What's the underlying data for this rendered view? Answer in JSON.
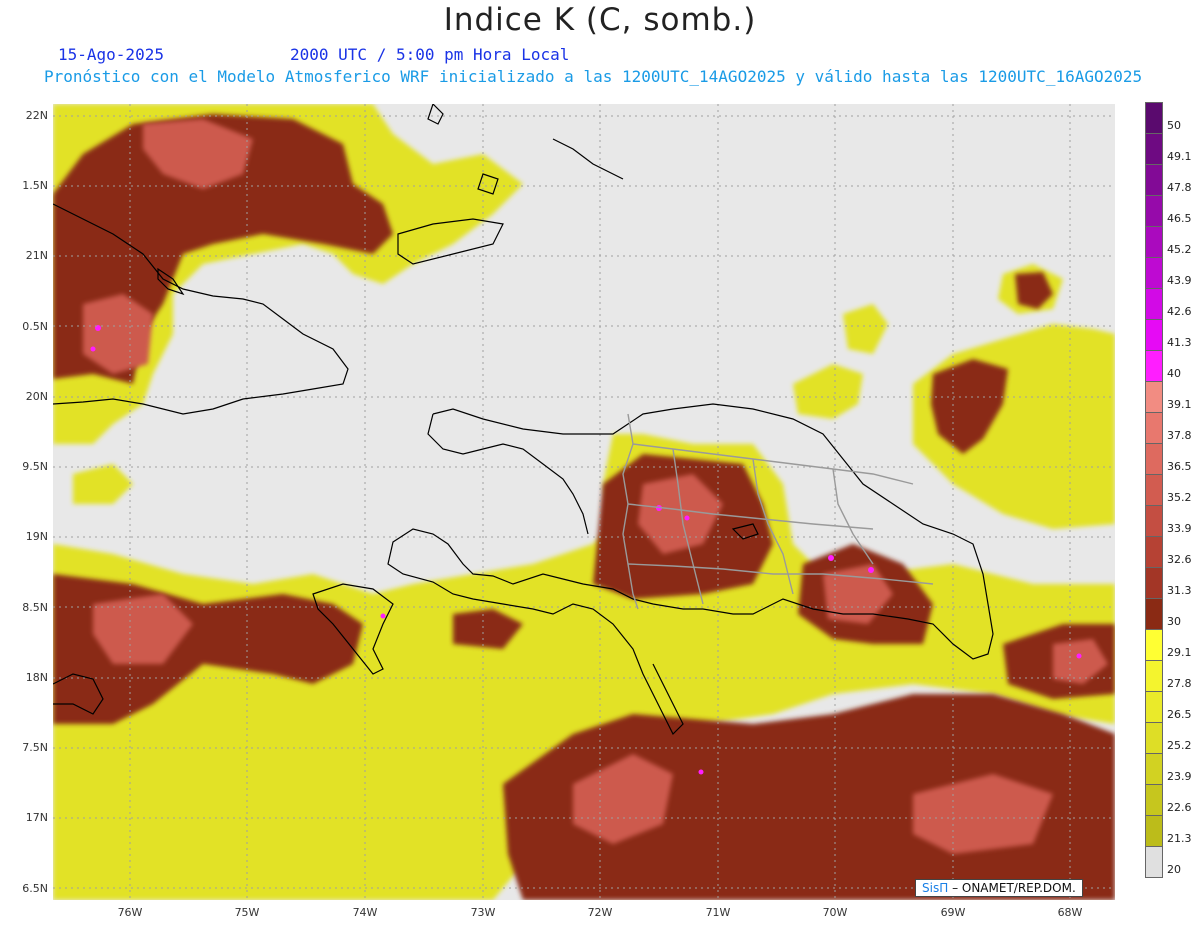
{
  "header": {
    "title": "Indice K (C, somb.)",
    "date": "15-Ago-2025",
    "time": "2000 UTC / 5:00 pm Hora Local",
    "subtitle": "Pronóstico con el Modelo Atmosferico WRF inicializado a las 1200UTC_14AGO2025 y válido hasta las  1200UTC_16AGO2025"
  },
  "axes": {
    "lat_labels": [
      "22N",
      "1.5N",
      "21N",
      "0.5N",
      "20N",
      "9.5N",
      "19N",
      "8.5N",
      "18N",
      "7.5N",
      "17N",
      "6.5N"
    ],
    "lon_labels": [
      "76W",
      "75W",
      "74W",
      "73W",
      "72W",
      "71W",
      "70W",
      "69W",
      "68W"
    ]
  },
  "colorbar": {
    "labels": [
      "50",
      "49.1",
      "47.8",
      "46.5",
      "45.2",
      "43.9",
      "42.6",
      "41.3",
      "40",
      "39.1",
      "37.8",
      "36.5",
      "35.2",
      "33.9",
      "32.6",
      "31.3",
      "30",
      "29.1",
      "27.8",
      "26.5",
      "25.2",
      "23.9",
      "22.6",
      "21.3",
      "20"
    ],
    "colors": [
      "#5a0a6e",
      "#6e0a82",
      "#820a96",
      "#960aaa",
      "#aa0abe",
      "#be0ad2",
      "#d20ae6",
      "#e60af5",
      "#ff1eff",
      "#f28c82",
      "#e8786e",
      "#de6a5f",
      "#d25c50",
      "#c44e42",
      "#b64234",
      "#a33626",
      "#8a2a14",
      "#ffff33",
      "#f4f42e",
      "#eaea2a",
      "#dede26",
      "#d2d222",
      "#c6c61e",
      "#bcbc1a",
      "#e0e0e0"
    ]
  },
  "credit": {
    "brand": "SisΠ",
    "text": "– ONAMET/REP.DOM."
  },
  "map_data": {
    "variable": "Indice K",
    "units": "C",
    "lat_range": [
      "16.5N",
      "22N"
    ],
    "lon_range": [
      "76W",
      "68W"
    ]
  }
}
